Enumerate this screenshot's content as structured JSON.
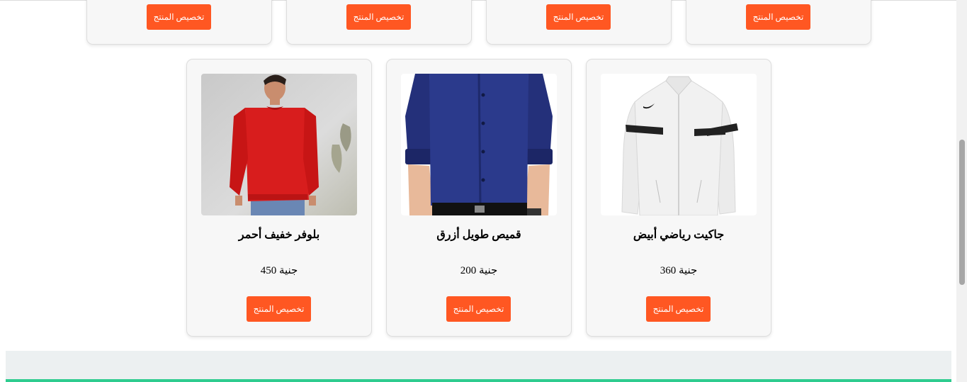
{
  "top_row": {
    "cards": [
      {
        "button_label": "تخصيص المنتج"
      },
      {
        "button_label": "تخصيص المنتج"
      },
      {
        "button_label": "تخصيص المنتج"
      },
      {
        "button_label": "تخصيص المنتج"
      }
    ]
  },
  "products": [
    {
      "name": "جاكيت رياضي أبيض",
      "price": "جنية 360",
      "button_label": "تخصيص المنتج",
      "image_icon": "white-track-jacket"
    },
    {
      "name": "قميص طويل أزرق",
      "price": "جنية 200",
      "button_label": "تخصيص المنتج",
      "image_icon": "navy-long-sleeve-shirt"
    },
    {
      "name": "بلوفر خفيف أحمر",
      "price": "جنية 450",
      "button_label": "تخصيص المنتج",
      "image_icon": "red-light-pullover"
    }
  ],
  "colors": {
    "accent": "#ff5722",
    "card_background": "#f7f7f7",
    "footer_background": "#ecf0f1",
    "footer_accent": "#2ecc8f"
  }
}
